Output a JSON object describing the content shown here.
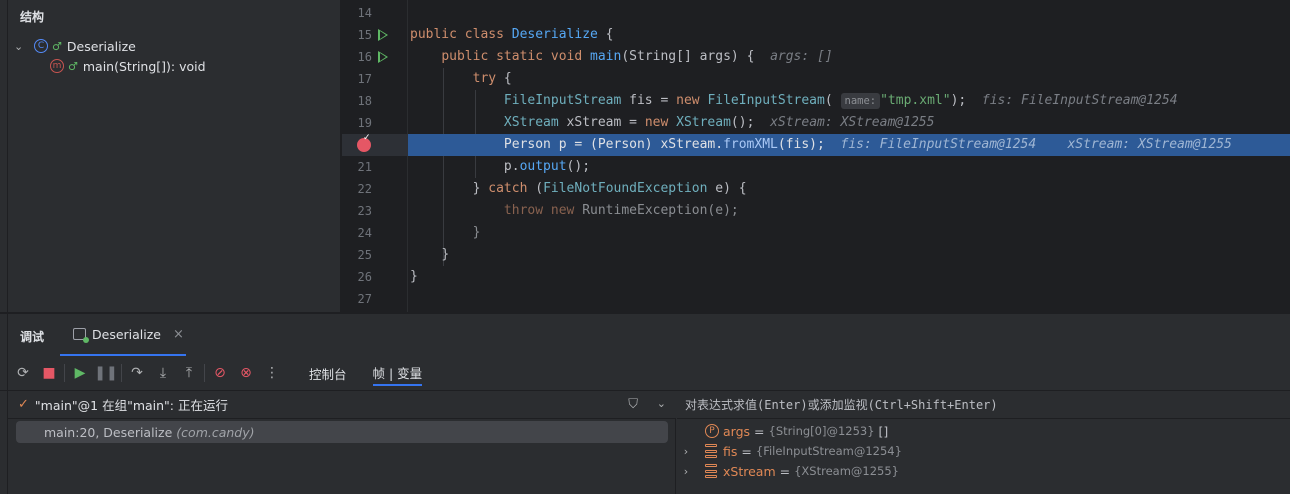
{
  "structure": {
    "title": "结构",
    "class_name": "Deserialize",
    "method": "main(String[]): void"
  },
  "editor": {
    "lines": [
      {
        "num": "14"
      },
      {
        "num": "15"
      },
      {
        "num": "16"
      },
      {
        "num": "17"
      },
      {
        "num": "18"
      },
      {
        "num": "19"
      },
      {
        "num": "20"
      },
      {
        "num": "21"
      },
      {
        "num": "22"
      },
      {
        "num": "23"
      },
      {
        "num": "24"
      },
      {
        "num": "25"
      },
      {
        "num": "26"
      },
      {
        "num": "27"
      }
    ],
    "code": {
      "l15_kw": "public class ",
      "l15_cls": "Deserialize",
      "l15_rest": " {",
      "l16_kw": "public static void ",
      "l16_fn": "main",
      "l16_rest": "(String[] args) {",
      "l16_hint": "args: []",
      "l17_kw": "try",
      "l17_rest": " {",
      "l18_ty": "FileInputStream",
      "l18_a": " fis = ",
      "l18_kw": "new ",
      "l18_ty2": "FileInputStream",
      "l18_paren": "(",
      "l18_param": "name:",
      "l18_str": "\"tmp.xml\"",
      "l18_end": ");",
      "l18_hint": "fis: FileInputStream@1254",
      "l19_ty": "XStream",
      "l19_a": " xStream = ",
      "l19_kw": "new ",
      "l19_ty2": "XStream",
      "l19_end": "();",
      "l19_hint": "xStream: XStream@1255",
      "l20_code": "Person p = (Person) xStream.",
      "l20_fn": "fromXML",
      "l20_end": "(fis);",
      "l20_hint1": "fis: FileInputStream@1254",
      "l20_hint2": "xStream: XStream@1255",
      "l21_a": "p.",
      "l21_fn": "output",
      "l21_end": "();",
      "l22_a": "} ",
      "l22_kw": "catch",
      "l22_b": " (",
      "l22_ty": "FileNotFoundException",
      "l22_c": " e) {",
      "l23_kw": "throw new ",
      "l23_rest": "RuntimeException(e);",
      "l24": "}",
      "l25": "}",
      "l26": "}"
    }
  },
  "debug": {
    "title": "调试",
    "tab_label": "Deserialize",
    "tab_close": "×",
    "toolbar_tabs": [
      "控制台",
      "帧 | 变量"
    ],
    "thread": "\"main\"@1 在组\"main\": 正在运行",
    "frame_method": "main:20, Deserialize",
    "frame_pkg": "(com.candy)",
    "eval_placeholder": "对表达式求值(Enter)或添加监视(Ctrl+Shift+Enter)",
    "variables": [
      {
        "name": "args",
        "value": "{String[0]@1253}",
        "extra": "[]",
        "kind": "param"
      },
      {
        "name": "fis",
        "value": "{FileInputStream@1254}",
        "extra": "",
        "kind": "field"
      },
      {
        "name": "xStream",
        "value": "{XStream@1255}",
        "extra": "",
        "kind": "field"
      }
    ]
  }
}
